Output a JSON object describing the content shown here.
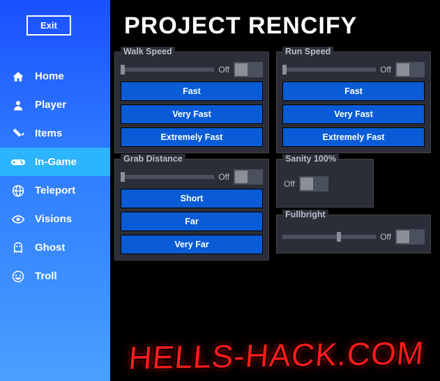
{
  "app_title": "PROJECT RENCIFY",
  "exit_label": "Exit",
  "sidebar": {
    "items": [
      {
        "label": "Home",
        "icon": "home-icon"
      },
      {
        "label": "Player",
        "icon": "user-icon"
      },
      {
        "label": "Items",
        "icon": "flashlight-icon"
      },
      {
        "label": "In-Game",
        "icon": "gamepad-icon",
        "active": true
      },
      {
        "label": "Teleport",
        "icon": "globe-icon"
      },
      {
        "label": "Visions",
        "icon": "eye-icon"
      },
      {
        "label": "Ghost",
        "icon": "ghost-icon"
      },
      {
        "label": "Troll",
        "icon": "laugh-icon"
      }
    ]
  },
  "panels": {
    "walk_speed": {
      "title": "Walk Speed",
      "off_label": "Off",
      "presets": [
        "Fast",
        "Very Fast",
        "Extremely Fast"
      ]
    },
    "run_speed": {
      "title": "Run Speed",
      "off_label": "Off",
      "presets": [
        "Fast",
        "Very Fast",
        "Extremely Fast"
      ]
    },
    "grab_distance": {
      "title": "Grab Distance",
      "off_label": "Off",
      "presets": [
        "Short",
        "Far",
        "Very Far"
      ]
    },
    "sanity": {
      "title": "Sanity 100%",
      "off_label": "Off"
    },
    "fullbright": {
      "title": "Fullbright",
      "off_label": "Off"
    }
  },
  "watermark": "HELLS-HACK.COM"
}
